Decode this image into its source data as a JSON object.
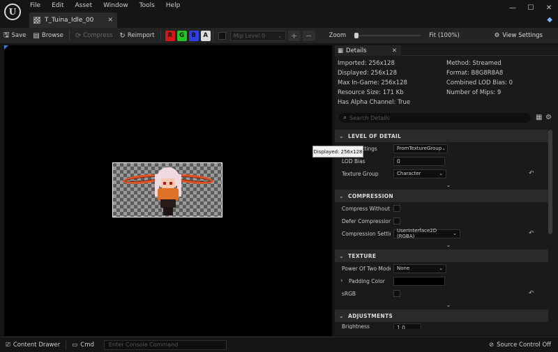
{
  "menu": [
    "File",
    "Edit",
    "Asset",
    "Window",
    "Tools",
    "Help"
  ],
  "tab": {
    "title": "T_Tuina_Idle_00"
  },
  "toolbar": {
    "save": "Save",
    "browse": "Browse",
    "compress": "Compress",
    "reimport": "Reimport",
    "channels": [
      "R",
      "G",
      "B",
      "A"
    ],
    "mip_level": "Mip Level 0",
    "zoom_label": "Zoom",
    "zoom_fit": "Fit (100%)",
    "view_settings": "View Settings"
  },
  "details": {
    "tab_title": "Details",
    "info_left": [
      "Imported: 256x128",
      "Displayed: 256x128",
      "Max In-Game: 256x128",
      "Resource Size: 171 Kb",
      "Has Alpha Channel: True"
    ],
    "info_right": [
      "Method: Streamed",
      "Format: B8G8R8A8",
      "Combined LOD Bias: 0",
      "Number of Mips: 9",
      ""
    ],
    "search_placeholder": "Search Details",
    "categories": {
      "lod": "LEVEL OF DETAIL",
      "compression": "COMPRESSION",
      "texture": "TEXTURE",
      "adjustments": "ADJUSTMENTS"
    },
    "lod": {
      "mip_settings_label": "Settings",
      "mip_settings_value": "FromTextureGroup",
      "lod_bias_label": "LOD Bias",
      "lod_bias_value": "0",
      "texture_group_label": "Texture Group",
      "texture_group_value": "Character"
    },
    "compression": {
      "compress_without_alpha_label": "Compress Without Al",
      "defer_compression_label": "Defer Compression",
      "compression_settings_label": "Compression Settings",
      "compression_settings_value": "UserInterface2D (RGBA)"
    },
    "texture": {
      "power_of_two_label": "Power Of Two Mode",
      "power_of_two_value": "None",
      "padding_color_label": "Padding Color",
      "srgb_label": "sRGB"
    },
    "adjustments": {
      "brightness_label": "Brightness",
      "brightness_value": "1.0"
    }
  },
  "tooltip": "Displayed: 256x128",
  "statusbar": {
    "content_drawer": "Content Drawer",
    "cmd": "Cmd",
    "console_placeholder": "Enter Console Command",
    "source_control": "Source Control Off"
  },
  "colors": {
    "channel_r": "#d41818",
    "channel_g": "#24c424",
    "channel_b": "#2f3fe0",
    "channel_a": "#dcdcdc",
    "accent": "#3a7bd5"
  }
}
